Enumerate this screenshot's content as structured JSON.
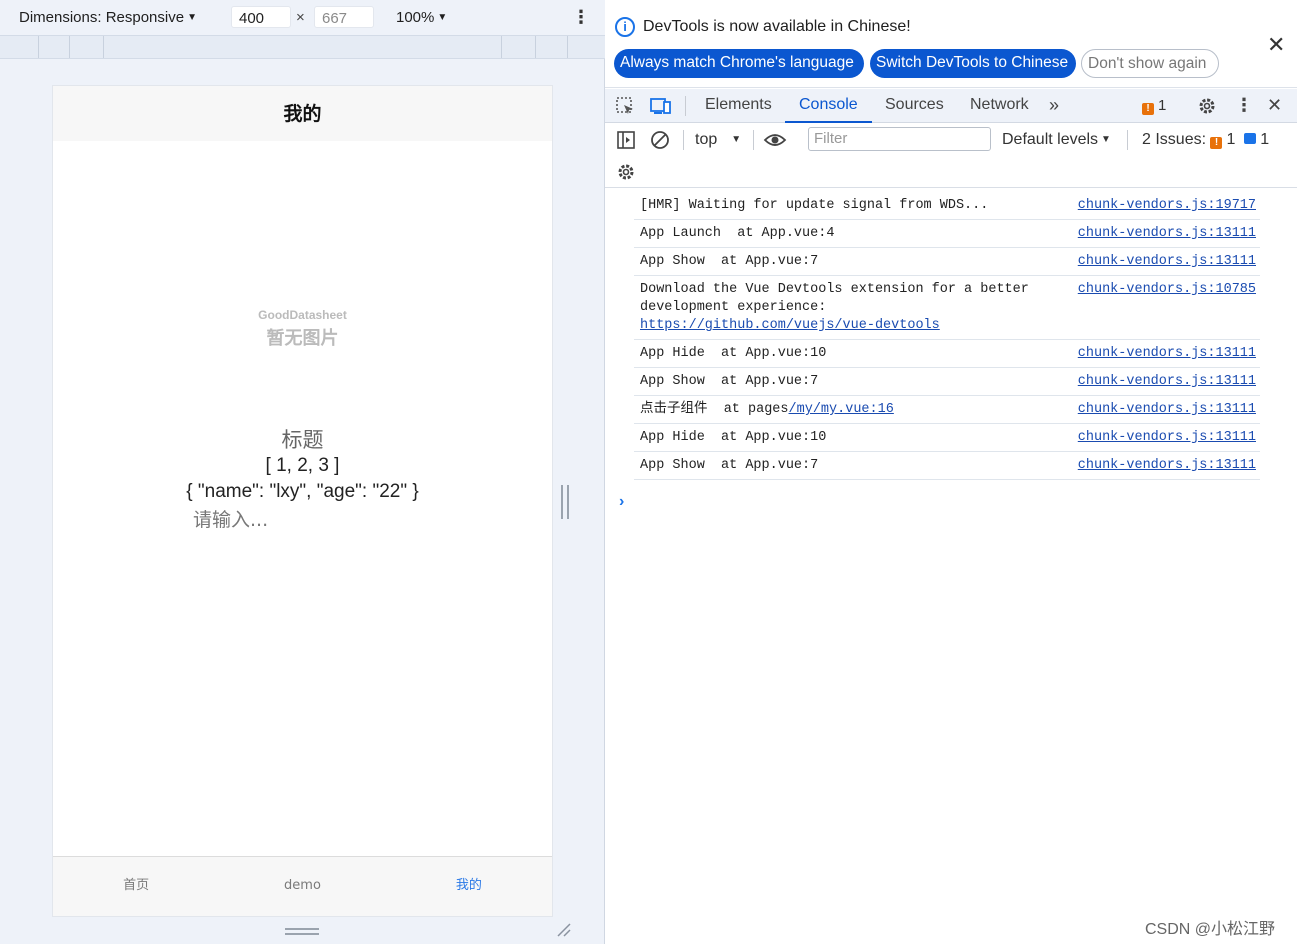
{
  "device_toolbar": {
    "dimensions_label": "Dimensions: Responsive",
    "width": "400",
    "height": "667",
    "times": "×",
    "zoom": "100%"
  },
  "app": {
    "nav_title": "我的",
    "placeholder_brand": "GoodDatasheet",
    "placeholder_text": "暂无图片",
    "heading": "标题",
    "array_line": "[ 1, 2, 3 ]",
    "object_line": "{ \"name\": \"lxy\", \"age\": \"22\" }",
    "input_placeholder": "请输入...",
    "tabs": [
      {
        "label": "首页"
      },
      {
        "label": "demo"
      },
      {
        "label": "我的"
      }
    ]
  },
  "banner": {
    "message": "DevTools is now available in Chinese!",
    "match_button": "Always match Chrome's language",
    "switch_button": "Switch DevTools to Chinese",
    "dismiss_button": "Don't show again"
  },
  "devtools_tabs": {
    "elements": "Elements",
    "console": "Console",
    "sources": "Sources",
    "network": "Network",
    "issue_count": "1"
  },
  "console_toolbar": {
    "context": "top",
    "filter_placeholder": "Filter",
    "levels": "Default levels",
    "issues_label": "2 Issues:",
    "issues_warn": "1",
    "issues_info": "1"
  },
  "console_rows": [
    {
      "msg": "[HMR] Waiting for update signal from WDS...",
      "src": "chunk-vendors.js:19717"
    },
    {
      "msg": "App Launch  at App.vue:4",
      "src": "chunk-vendors.js:13111"
    },
    {
      "msg": "App Show  at App.vue:7",
      "src": "chunk-vendors.js:13111"
    },
    {
      "msg": "Download the Vue Devtools extension for a better development experience:",
      "link": "https://github.com/vuejs/vue-devtools",
      "src": "chunk-vendors.js:10785"
    },
    {
      "msg": "App Hide  at App.vue:10",
      "src": "chunk-vendors.js:13111"
    },
    {
      "msg": "App Show  at App.vue:7",
      "src": "chunk-vendors.js:13111"
    },
    {
      "msg": "点击子组件  at pages",
      "link": "/my/my.vue:16",
      "src": "chunk-vendors.js:13111"
    },
    {
      "msg": "App Hide  at App.vue:10",
      "src": "chunk-vendors.js:13111"
    },
    {
      "msg": "App Show  at App.vue:7",
      "src": "chunk-vendors.js:13111"
    }
  ],
  "prompt_symbol": "›",
  "watermark": "CSDN @小松江野",
  "colors": {
    "accent": "#0b57d0",
    "warning": "#e8710a",
    "link": "#1a4bb0"
  }
}
